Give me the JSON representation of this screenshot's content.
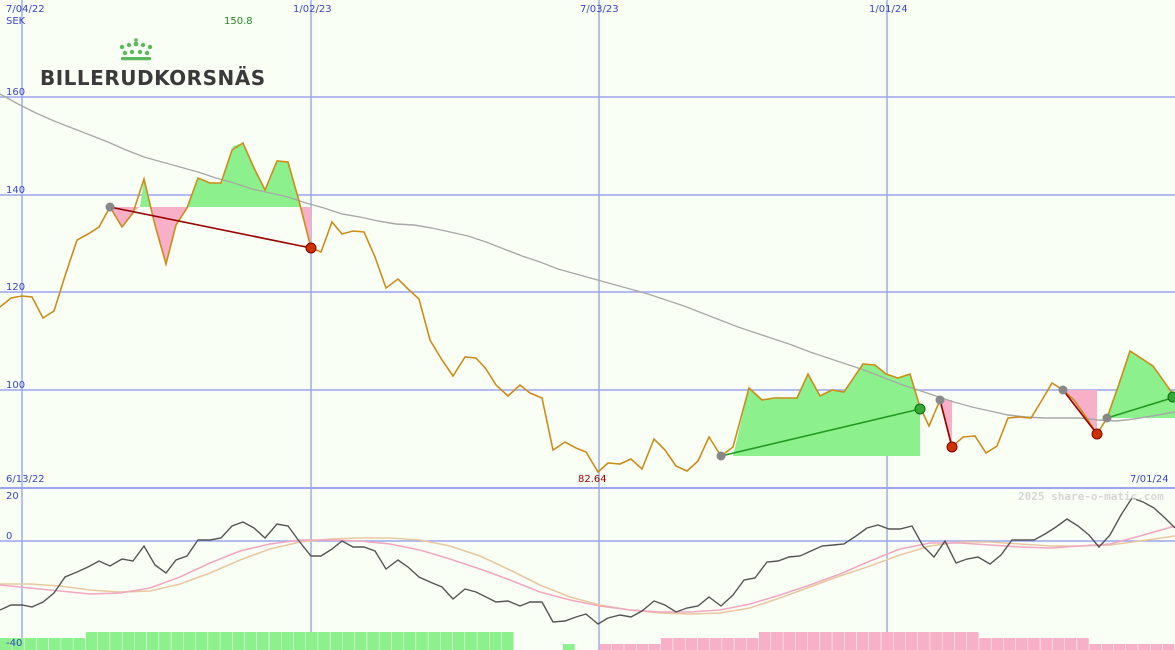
{
  "chart_data": {
    "type": "line",
    "company": "BILLERUDKORSNÄS",
    "currency": "SEK",
    "top_dates": [
      "7/04/22",
      "1/02/23",
      "7/03/23",
      "1/01/24"
    ],
    "bottom_dates": [
      "6/13/22",
      "7/01/24"
    ],
    "price_axis": {
      "ticks": [
        "160",
        "140",
        "120",
        "100"
      ],
      "range": [
        80,
        170
      ]
    },
    "osc_axis": {
      "ticks": [
        "20",
        "0",
        "-40"
      ],
      "range": [
        -40,
        20
      ]
    },
    "high_label": "150.8",
    "low_label": "82.64",
    "watermark": "2025 share-o-matic.com",
    "price": [
      117.6,
      119.3,
      118.8,
      114.6,
      115.9,
      122.9,
      130.1,
      131.7,
      133.0,
      137.5,
      132.8,
      135.2,
      143.1,
      133.0,
      125.6,
      133.5,
      135.5,
      143.1,
      142.1,
      142.1,
      149.0,
      149.8,
      143.0,
      139.8,
      146.3,
      146.1,
      138.1,
      129.2,
      128.2,
      134.7,
      133.1,
      133.1,
      127.3,
      120.8,
      122.3,
      119.6,
      114.8,
      109.6,
      106.5,
      102.7,
      106.9,
      106.5,
      104.4,
      100.5,
      98.1,
      99.9,
      99.9,
      97.9,
      87.6,
      89.2,
      87.9,
      85.2,
      83.7,
      85.0,
      85.0,
      86.0,
      83.7,
      90.1,
      88.0,
      84.9,
      84.0,
      85.8,
      90.3,
      87.5,
      93.6,
      100.7,
      98.6,
      98.9,
      98.9,
      98.9,
      103.5,
      99.2,
      100.1,
      99.2,
      102.1,
      105.2,
      105.2,
      102.5,
      102.1,
      100.1,
      95.0,
      98.1,
      88.9,
      89.8,
      90.4,
      87.3,
      89.3,
      94.2,
      94.2,
      94.2,
      97.4,
      101.4,
      100.4,
      99.2,
      91.5,
      93.8,
      100.9,
      103.1,
      102.7,
      98.1,
      96.4
    ],
    "moving_average": [
      159.7,
      157.6,
      155.5,
      153.7,
      152.2,
      150.9,
      149.2,
      147.6,
      146.1,
      144.5,
      143.5,
      142.6,
      141.9,
      141.4,
      140.5,
      139.4,
      138.8,
      138.1,
      137.1,
      136.4,
      135.5,
      134.6,
      133.9,
      133.4,
      132.9,
      132.1,
      131.2,
      130.1,
      128.8,
      127.6,
      126.4,
      125.0,
      123.6,
      122.6,
      121.9,
      121.0,
      120.2,
      119.3,
      118.3,
      117.1,
      115.5,
      114.1,
      112.4,
      111.0,
      109.6,
      108.1,
      106.8,
      105.6,
      104.5,
      103.4,
      102.6,
      101.9,
      101.3,
      100.6,
      99.9,
      99.1,
      98.0,
      97.0,
      96.1,
      95.6,
      95.2,
      95.0,
      94.7,
      94.7,
      95.0,
      95.4,
      95.6
    ],
    "macd": [
      -14.3,
      -13.1,
      -13.1,
      -14.0,
      -11.9,
      -7.6,
      -5.4,
      -4.1,
      -1.4,
      -3.6,
      -3.8,
      0.9,
      -4.9,
      -8.9,
      -4.8,
      -3.5,
      1.3,
      0.8,
      1.3,
      4.9,
      5.5,
      3.7,
      0.8,
      5.1,
      4.9,
      0.0,
      -2.0,
      -2.9,
      -0.4,
      0.4,
      -1.1,
      -1.8,
      -4.7,
      -6.2,
      -7.4,
      -8.6,
      -10.6,
      -11.8,
      -12.1,
      -11.5,
      -13.9,
      -13.4,
      -13.2,
      -15.1,
      -15.8,
      -16.4,
      -15.3,
      -18.9,
      -19.2,
      -21.9,
      -20.6,
      -21.0,
      -22.1,
      -23.6,
      -21.2,
      -19.1,
      -22.1,
      -20.4,
      -20.2,
      -14.3,
      -13.8,
      -7.7,
      -11.1,
      -10.2,
      -6.4,
      -5.0,
      -2.1,
      -4.3,
      -3.0,
      -1.1,
      -0.4,
      1.2,
      -0.5,
      1.5,
      -1.3,
      -0.4,
      -0.5,
      -1.6,
      -2.6,
      -1.4,
      -0.3,
      -1.9,
      -0.8,
      -1.3,
      -0.9,
      -0.5,
      -0.4,
      -1.4,
      -0.3,
      -2.0,
      -0.1,
      4.2,
      4.4,
      3.7,
      2.7,
      3.0,
      3.4
    ],
    "signal": [
      -8.6,
      -9.5,
      -10.5,
      -10.9,
      -10.9,
      -10.4,
      -9.6,
      -8.6,
      -7.4,
      -6.5,
      -5.5,
      -4.5,
      -4.4,
      -4.6,
      -4.5,
      -3.9,
      -2.9,
      -1.7,
      -0.6,
      0.3,
      0.9,
      1.3,
      1.3,
      0.9,
      0.6,
      0.1,
      -0.5,
      -1.1,
      -1.8,
      -2.6,
      -3.5,
      -4.5,
      -5.5,
      -6.6,
      -7.6,
      -8.7,
      -9.8,
      -10.8,
      -11.8,
      -12.7,
      -13.6,
      -14.4,
      -15.2,
      -16.0,
      -16.7,
      -17.3,
      -17.8,
      -18.2,
      -18.6,
      -18.8,
      -18.9,
      -18.8,
      -18.5,
      -18.0,
      -17.3,
      -16.4,
      -15.2,
      -13.8,
      -12.3,
      -10.9,
      -9.6,
      -8.2,
      -6.9,
      -5.6,
      -4.4,
      -3.3,
      -2.4,
      -1.7,
      -1.1,
      -0.8,
      -0.5,
      -0.4,
      -0.4,
      -0.4,
      -0.4,
      -0.5,
      -0.5,
      -0.6,
      -0.7,
      -0.8,
      -0.8,
      -0.8,
      -0.6,
      -0.3,
      0.2,
      0.8,
      1.5,
      2.0,
      2.3
    ],
    "histogram": [
      2,
      2,
      2,
      2,
      2,
      2,
      2,
      3,
      3,
      3,
      3,
      3,
      3,
      3,
      3,
      3,
      3,
      3,
      3,
      3,
      3,
      3,
      3,
      3,
      3,
      3,
      3,
      3,
      3,
      3,
      3,
      3,
      3,
      3,
      3,
      3,
      3,
      3,
      3,
      3,
      3,
      3,
      0,
      0,
      0,
      0,
      1,
      0,
      0,
      -1,
      -1,
      -1,
      -1,
      -1,
      -2,
      -2,
      -2,
      -2,
      -2,
      -2,
      -2,
      -2,
      -3,
      -3,
      -3,
      -3,
      -3,
      -3,
      -3,
      -3,
      -3,
      -3,
      -3,
      -3,
      -3,
      -3,
      -3,
      -3,
      -3,
      -3,
      -2,
      -2,
      -2,
      -2,
      -2,
      -2,
      -2,
      -2,
      -2,
      -1,
      -1,
      -1,
      -1,
      -1,
      -1,
      -1
    ]
  },
  "colors": {
    "price_line": "#cc8c1a",
    "moving_average": "#a8a8a8",
    "gain_fill": "#8cf08c",
    "loss_fill": "#f8b0c8",
    "gain_trend": "#229922",
    "loss_trend": "#990000",
    "grid": "#9aa6ee",
    "macd": "#555555",
    "signal_pink": "#f0a8c0",
    "signal_tan": "#e8c8a0",
    "logo_crown": "#5cb85c",
    "high_text": "#228822",
    "low_text": "#990000",
    "axis_text": "#3a45c8"
  }
}
